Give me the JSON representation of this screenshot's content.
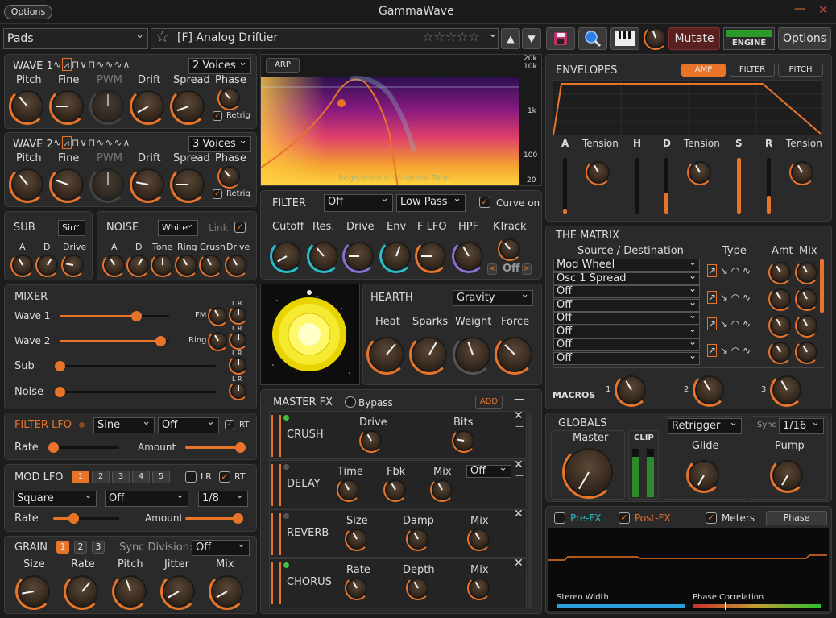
{
  "window": {
    "title": "GammaWave",
    "options_btn": "Options",
    "minimize": "—",
    "close": "✕"
  },
  "toolbar": {
    "category": "Pads",
    "preset": "[F] Analog Driftier",
    "stars": "☆☆☆☆☆",
    "up": "▲",
    "down": "▼",
    "mutate": "Mutate",
    "engine": "ENGINE",
    "options": "Options"
  },
  "wave1": {
    "title": "WAVE 1",
    "voices": "2 Voices",
    "labels": [
      "Pitch",
      "Fine",
      "PWM",
      "Drift",
      "Spread",
      "Phase"
    ],
    "retrig": "Retrig"
  },
  "wave2": {
    "title": "WAVE 2",
    "voices": "3 Voices",
    "labels": [
      "Pitch",
      "Fine",
      "PWM",
      "Drift",
      "Spread",
      "Phase"
    ],
    "retrig": "Retrig"
  },
  "sub": {
    "title": "SUB",
    "shape": "Sin",
    "labels": [
      "A",
      "D",
      "Drive"
    ]
  },
  "noise": {
    "title": "NOISE",
    "type": "White",
    "link": "Link",
    "labels": [
      "A",
      "D",
      "Tone",
      "Ring",
      "Crush",
      "Drive"
    ]
  },
  "mixer": {
    "title": "MIXER",
    "rows": [
      "Wave 1",
      "Wave 2",
      "Sub",
      "Noise"
    ],
    "fm": "FM",
    "ring": "Ring",
    "lr": "L R",
    "levels": [
      0.7,
      0.92,
      0.0,
      0.0
    ]
  },
  "filter_lfo": {
    "title": "FILTER LFO",
    "shape": "Sine",
    "target": "Off",
    "rt": "RT",
    "rate": "Rate",
    "amount": "Amount",
    "rate_val": 0.0,
    "amount_val": 0.95
  },
  "mod_lfo": {
    "title": "MOD LFO",
    "slots": [
      "1",
      "2",
      "3",
      "4",
      "5"
    ],
    "lr": "LR",
    "rt": "RT",
    "shape": "Square",
    "target": "Off",
    "division": "1/8",
    "rate": "Rate",
    "amount": "Amount",
    "rate_val": 0.3,
    "amount_val": 0.9
  },
  "grain": {
    "title": "GRAIN",
    "slots": [
      "1",
      "2",
      "3"
    ],
    "sync_label": "Sync Division:",
    "sync": "Off",
    "labels": [
      "Size",
      "Rate",
      "Pitch",
      "Jitter",
      "Mix"
    ]
  },
  "spectrum": {
    "arp": "ARP",
    "ticks": [
      "20k",
      "10k",
      "1k",
      "100",
      "20"
    ],
    "watermark": "Registered to: Shadow Tone"
  },
  "filter": {
    "title": "FILTER",
    "mode": "Off",
    "type": "Low Pass",
    "curve": "Curve on",
    "labels": [
      "Cutoff",
      "Res.",
      "Drive",
      "Env",
      "F LFO",
      "HPF",
      "KTrack"
    ],
    "ktrack_val": "Off",
    "prev": "<",
    "next": ">"
  },
  "hearth": {
    "title": "HEARTH",
    "mode": "Gravity",
    "labels": [
      "Heat",
      "Sparks",
      "Weight",
      "Force"
    ]
  },
  "master_fx": {
    "title": "MASTER FX",
    "bypass": "Bypass",
    "add": "ADD",
    "minus": "—",
    "rows": [
      {
        "name": "CRUSH",
        "params": [
          "Drive",
          "Bits"
        ],
        "led": "#3fbf3f"
      },
      {
        "name": "DELAY",
        "params": [
          "Time",
          "Fbk",
          "Mix"
        ],
        "sync": "Off",
        "led": "#555"
      },
      {
        "name": "REVERB",
        "params": [
          "Size",
          "Damp",
          "Mix"
        ],
        "led": "#555"
      },
      {
        "name": "CHORUS",
        "params": [
          "Rate",
          "Depth",
          "Mix"
        ],
        "led": "#3fbf3f"
      }
    ]
  },
  "envelopes": {
    "title": "ENVELOPES",
    "tabs": [
      "AMP",
      "FILTER",
      "PITCH"
    ],
    "labels": [
      "A",
      "Tension",
      "H",
      "D",
      "Tension",
      "S",
      "R",
      "Tension"
    ],
    "levels": {
      "A": 0.02,
      "H": 0.0,
      "D": 0.38,
      "S": 1.0,
      "R": 0.32
    }
  },
  "matrix": {
    "title": "THE MATRIX",
    "col_src": "Source / Destination",
    "col_type": "Type",
    "col_amt": "Amt",
    "col_mix": "Mix",
    "rows": [
      "Mod Wheel",
      "Osc 1 Spread",
      "Off",
      "Off",
      "Off",
      "Off",
      "Off",
      "Off"
    ],
    "macros": "MACROS",
    "macro_nums": [
      "1",
      "2",
      "3"
    ]
  },
  "globals": {
    "title": "GLOBALS",
    "master": "Master",
    "clip": "CLIP",
    "retrigger": "Retrigger",
    "glide": "Glide",
    "sync": "Sync",
    "division": "1/16",
    "pump": "Pump"
  },
  "scope": {
    "prefx": "Pre-FX",
    "postfx": "Post-FX",
    "meters": "Meters",
    "phase": "Phase",
    "stereo": "Stereo Width",
    "corr": "Phase Correlation"
  },
  "colors": {
    "accent": "#e8742a",
    "cyan": "#2bbdc7",
    "green": "#3fbf3f",
    "mutate": "#5a2020"
  }
}
